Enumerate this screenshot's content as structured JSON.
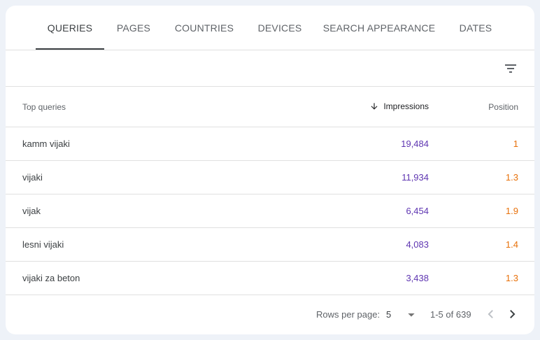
{
  "tabs": [
    {
      "label": "QUERIES",
      "active": true
    },
    {
      "label": "PAGES"
    },
    {
      "label": "COUNTRIES"
    },
    {
      "label": "DEVICES"
    },
    {
      "label": "SEARCH APPEARANCE"
    },
    {
      "label": "DATES"
    }
  ],
  "table": {
    "headers": {
      "query": "Top queries",
      "impressions": "Impressions",
      "position": "Position"
    },
    "sort": {
      "column": "impressions",
      "direction": "descending",
      "icon": "arrow-down-icon"
    },
    "rows": [
      {
        "query": "kamm vijaki",
        "impressions": "19,484",
        "position": "1"
      },
      {
        "query": "vijaki",
        "impressions": "11,934",
        "position": "1.3"
      },
      {
        "query": "vijak",
        "impressions": "6,454",
        "position": "1.9"
      },
      {
        "query": "lesni vijaki",
        "impressions": "4,083",
        "position": "1.4"
      },
      {
        "query": "vijaki za beton",
        "impressions": "3,438",
        "position": "1.3"
      }
    ]
  },
  "pagination": {
    "rows_per_page_label": "Rows per page:",
    "rows_per_page": "5",
    "range": "1-5 of 639"
  },
  "icons": {
    "filter": "filter-list-icon",
    "caret": "arrow-drop-down-icon",
    "prev": "chevron-left-icon",
    "next": "chevron-right-icon"
  },
  "colors": {
    "impressions": "#5e35b1",
    "position": "#e8710a",
    "active_tab": "#3c4043"
  }
}
